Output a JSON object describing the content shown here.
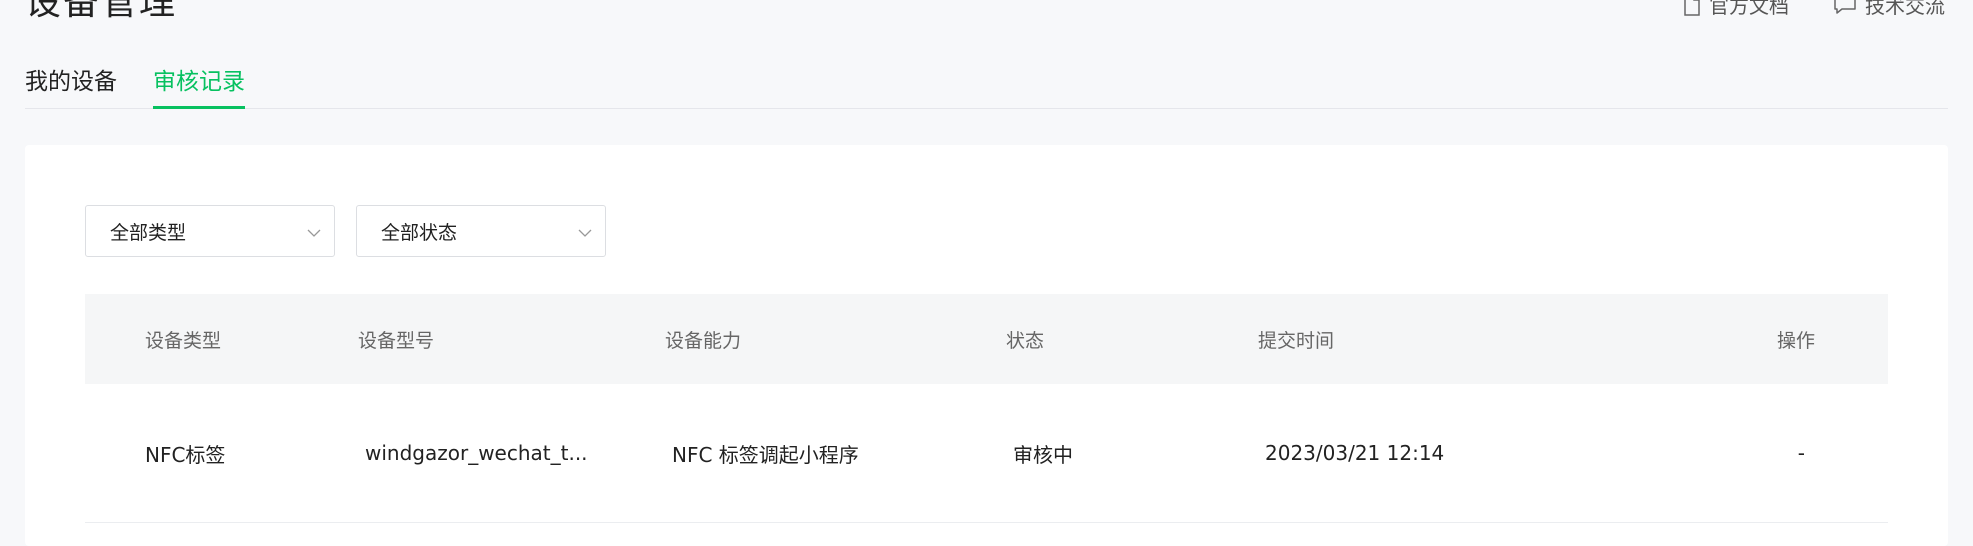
{
  "page": {
    "title": "设备管理"
  },
  "top_links": [
    {
      "label": "官方文档",
      "icon": "document-icon"
    },
    {
      "label": "技术交流",
      "icon": "chat-bubble-icon"
    }
  ],
  "tabs": [
    {
      "label": "我的设备",
      "active": false
    },
    {
      "label": "审核记录",
      "active": true
    }
  ],
  "filters": {
    "type": {
      "value": "全部类型"
    },
    "status": {
      "value": "全部状态"
    }
  },
  "table": {
    "columns": [
      "设备类型",
      "设备型号",
      "设备能力",
      "状态",
      "提交时间",
      "操作"
    ],
    "rows": [
      [
        "NFC标签",
        "windgazor_wechat_t...",
        "NFC 标签调起小程序",
        "审核中",
        "2023/03/21 12:14",
        "-"
      ]
    ]
  },
  "colors": {
    "accent": "#07c160",
    "background": "#f7f8fa",
    "header_bg": "#f5f6f7"
  }
}
